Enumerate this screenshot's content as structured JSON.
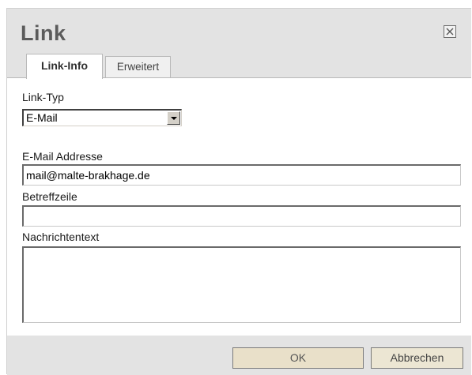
{
  "dialog": {
    "title": "Link",
    "close_icon": "close-icon"
  },
  "tabs": [
    {
      "label": "Link-Info",
      "active": true
    },
    {
      "label": "Erweitert",
      "active": false
    }
  ],
  "form": {
    "link_type_label": "Link-Typ",
    "link_type_value": "E-Mail",
    "email_label": "E-Mail Addresse",
    "email_value": "mail@malte-brakhage.de",
    "subject_label": "Betreffzeile",
    "subject_value": "",
    "message_label": "Nachrichtentext",
    "message_value": ""
  },
  "buttons": {
    "ok_label": "OK",
    "cancel_label": "Abbrechen"
  }
}
